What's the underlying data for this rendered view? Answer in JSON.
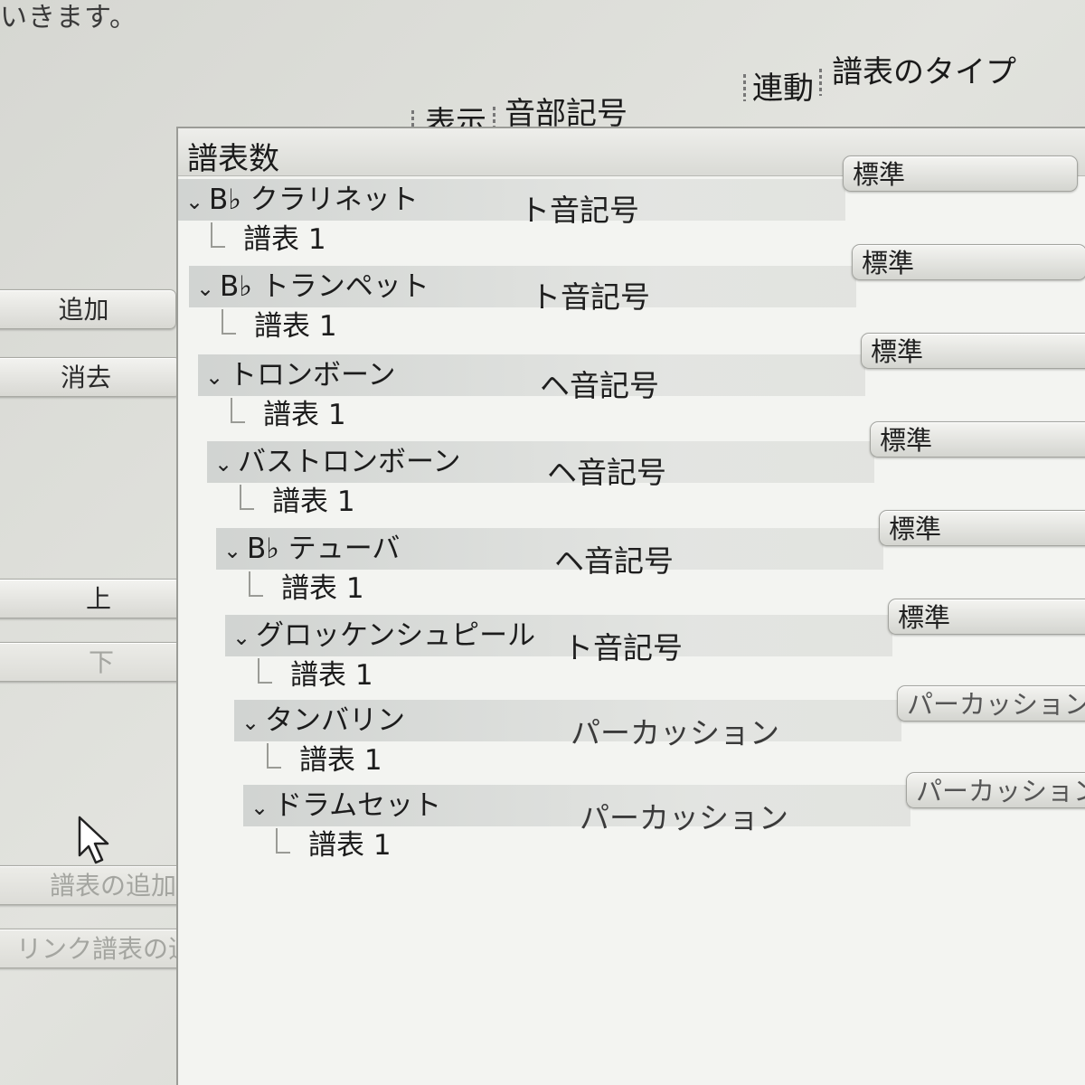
{
  "top_text": "いきます。",
  "left_buttons": {
    "add": "追加",
    "delete": "消去",
    "up": "上",
    "down": "下",
    "add_staff": "譜表の追加",
    "add_linked_staff": "リンク譜表の追加"
  },
  "columns": {
    "staff_count": "譜表数",
    "display": "表示",
    "clef": "音部記号",
    "link": "連動",
    "staff_type": "譜表のタイプ"
  },
  "instruments": [
    {
      "name": "B♭ クラリネット",
      "staff": "譜表 1",
      "clef": "ト音記号",
      "type": "標準"
    },
    {
      "name": "B♭ トランペット",
      "staff": "譜表 1",
      "clef": "ト音記号",
      "type": "標準"
    },
    {
      "name": "トロンボーン",
      "staff": "譜表 1",
      "clef": "ヘ音記号",
      "type": "標準"
    },
    {
      "name": "バストロンボーン",
      "staff": "譜表 1",
      "clef": "ヘ音記号",
      "type": "標準"
    },
    {
      "name": "B♭ テューバ",
      "staff": "譜表 1",
      "clef": "ヘ音記号",
      "type": "標準"
    },
    {
      "name": "グロッケンシュピール",
      "staff": "譜表 1",
      "clef": "ト音記号",
      "type": "標準"
    },
    {
      "name": "タンバリン",
      "staff": "譜表 1",
      "clef": "パーカッション",
      "type": "パーカッション"
    },
    {
      "name": "ドラムセット",
      "staff": "譜表 1",
      "clef": "パーカッション",
      "type": "パーカッション"
    }
  ],
  "icons": {
    "expand": "chevron-down-icon",
    "cursor": "mouse-pointer-icon"
  }
}
